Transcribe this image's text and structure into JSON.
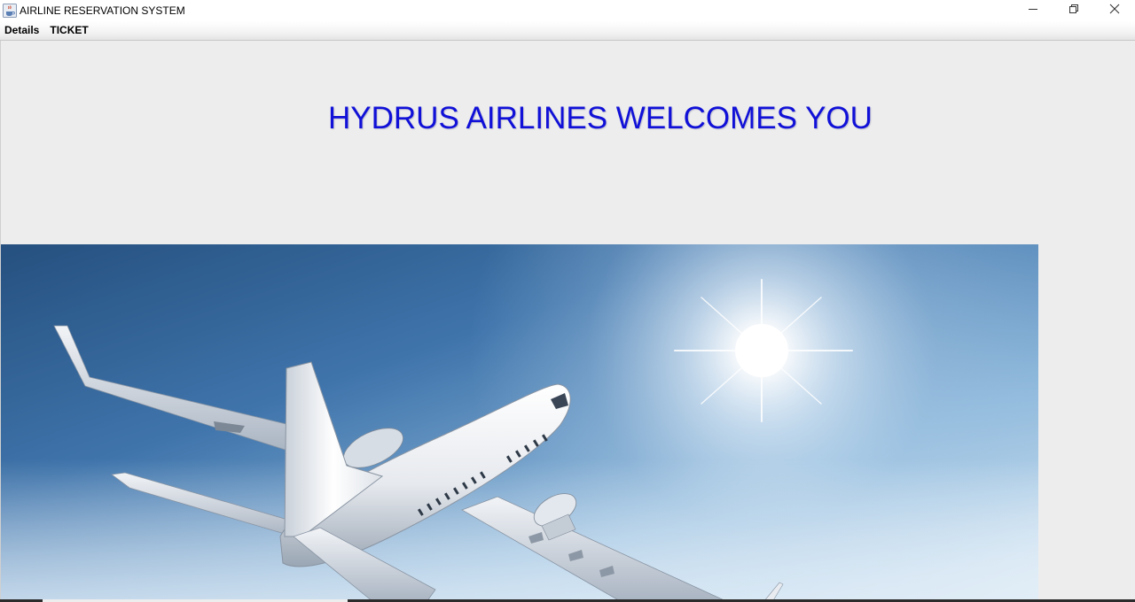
{
  "window": {
    "title": "AIRLINE RESERVATION SYSTEM",
    "app_icon": "java-coffee-cup-icon",
    "controls": [
      "minimize-icon",
      "restore-icon",
      "close-icon"
    ]
  },
  "menubar": {
    "items": [
      {
        "label": "Details"
      },
      {
        "label": "TICKET"
      }
    ]
  },
  "main": {
    "welcome_text": "HYDRUS AIRLINES WELCOMES YOU",
    "welcome_color": "#1010d8",
    "hero_image": "airplane-in-blue-sky-with-sun"
  },
  "colors": {
    "window_bg": "#ededed",
    "sky_dark": "#2f5a8e",
    "sky_light": "#cfe3f2"
  }
}
